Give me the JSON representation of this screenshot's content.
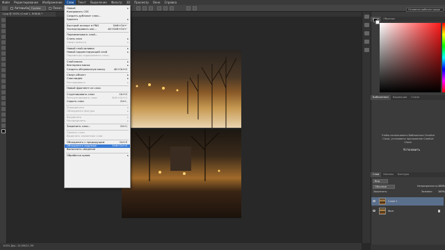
{
  "menubar": {
    "items": [
      {
        "label": "Файл"
      },
      {
        "label": "Редактирование"
      },
      {
        "label": "Изображение"
      },
      {
        "label": "Слои"
      },
      {
        "label": "Текст"
      },
      {
        "label": "Выделение"
      },
      {
        "label": "Фильтр"
      },
      {
        "label": "3D"
      },
      {
        "label": "Просмотр"
      },
      {
        "label": "Окно"
      },
      {
        "label": "Справка"
      }
    ],
    "active_index": 3
  },
  "options_bar": {
    "autoselect_label": "Автовыбор:",
    "autoselect_value": "Группа",
    "transform_label": "Показ. упр. элем."
  },
  "workspace_select": "Основная рабочая среда",
  "document_tab": "1.jpg @ 100% (Слой 1, RGB/8) *",
  "status": "100%   Док: 10,5М/21,7M",
  "layer_menu": {
    "items": [
      {
        "label": "Новый",
        "arrow": true
      },
      {
        "label": "Копировать CSS"
      },
      {
        "label": "Создать дубликат слоя..."
      },
      {
        "label": "Удалить",
        "arrow": true
      },
      {
        "sep": true
      },
      {
        "label": "Быстрый экспорт в PNG",
        "shortcut": "Shift+Ctrl+'"
      },
      {
        "label": "Экспортировать как...",
        "shortcut": "Alt+Shift+Ctrl+'"
      },
      {
        "sep": true
      },
      {
        "label": "Переименовать слой..."
      },
      {
        "label": "Стиль слоя",
        "arrow": true
      },
      {
        "label": "Смарт-фильтр",
        "disabled": true,
        "arrow": true
      },
      {
        "sep": true
      },
      {
        "label": "Новый слой-заливка",
        "arrow": true
      },
      {
        "label": "Новый корректирующий слой",
        "arrow": true
      },
      {
        "label": "Параметры содержимого слоя...",
        "disabled": true
      },
      {
        "sep": true
      },
      {
        "label": "Слой-маска",
        "arrow": true
      },
      {
        "label": "Векторная маска",
        "arrow": true
      },
      {
        "label": "Создать обтравочную маску",
        "shortcut": "Alt+Ctrl+G"
      },
      {
        "sep": true
      },
      {
        "label": "Смарт-объект",
        "arrow": true
      },
      {
        "label": "Слои видео",
        "arrow": true
      },
      {
        "label": "Растрировать",
        "disabled": true,
        "arrow": true
      },
      {
        "sep": true
      },
      {
        "label": "Новый фрагмент из слоя"
      },
      {
        "sep": true
      },
      {
        "label": "Сгруппировать слои",
        "shortcut": "Ctrl+G"
      },
      {
        "label": "Разгруппировать слои",
        "disabled": true,
        "shortcut": "Shift+Ctrl+G"
      },
      {
        "label": "Скрыть слои",
        "shortcut": "Ctrl+,"
      },
      {
        "sep": true
      },
      {
        "label": "Упорядочить",
        "disabled": true,
        "arrow": true
      },
      {
        "label": "Объединить фигуры",
        "disabled": true,
        "arrow": true
      },
      {
        "sep": true
      },
      {
        "label": "Выровнять",
        "disabled": true,
        "arrow": true
      },
      {
        "label": "Распределить",
        "disabled": true,
        "arrow": true
      },
      {
        "sep": true
      },
      {
        "label": "Закрепить слои...",
        "shortcut": "Ctrl+/"
      },
      {
        "sep": true
      },
      {
        "label": "Связать слои",
        "disabled": true
      },
      {
        "label": "Выделить связанные слои",
        "disabled": true
      },
      {
        "sep": true
      },
      {
        "label": "Объединить с предыдущим",
        "shortcut": "Ctrl+E"
      },
      {
        "label": "Объединить видимые",
        "shortcut": "Shift+Ctrl+E",
        "highlighted": true
      },
      {
        "label": "Выполнить сведение"
      },
      {
        "sep": true
      },
      {
        "label": "Обработка краев",
        "arrow": true
      }
    ]
  },
  "color_panel": {
    "tabs": [
      "Цвет",
      "Образцы"
    ],
    "accent_color": "#ff1a1a"
  },
  "libraries_panel": {
    "tabs": [
      "Библиотеки",
      "Коррекция",
      "Стили"
    ],
    "message": "Чтобы использовать библиотеки Creative Cloud, установите приложение Creative Cloud.",
    "install_label": "Установить"
  },
  "layers_panel": {
    "tabs": [
      "Слои",
      "Каналы",
      "Контуры"
    ],
    "filter_label": "Вид",
    "blend_mode": "Обычные",
    "opacity_label": "Непрозрачность:",
    "opacity_value": "100%",
    "lock_label": "Закрепить:",
    "fill_label": "Заливка:",
    "fill_value": "100%",
    "layers": [
      {
        "name": "Слой 1",
        "selected": true
      },
      {
        "name": "Фон",
        "selected": false
      }
    ]
  }
}
